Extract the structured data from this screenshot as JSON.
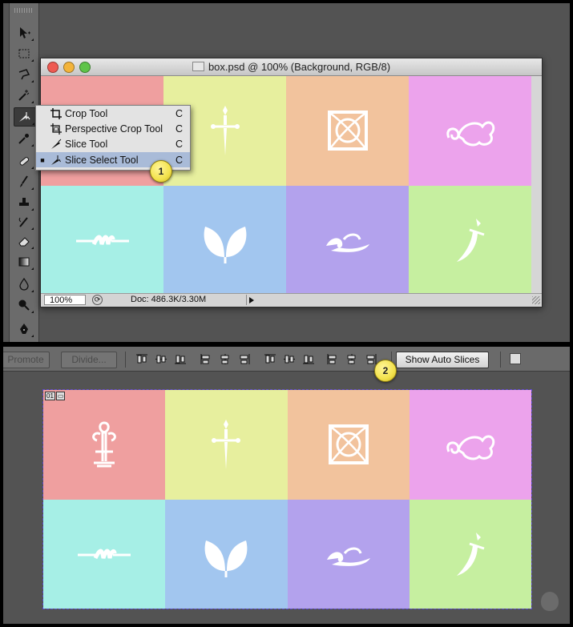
{
  "document": {
    "title": "box.psd @ 100% (Background, RGB/8)",
    "zoom": "100%",
    "doc_info": "Doc: 486.3K/3.30M"
  },
  "flyout_menu": {
    "items": [
      {
        "label": "Crop Tool",
        "key": "C",
        "selected": false,
        "icon": "crop-icon"
      },
      {
        "label": "Perspective Crop Tool",
        "key": "C",
        "selected": false,
        "icon": "perspective-crop-icon"
      },
      {
        "label": "Slice Tool",
        "key": "C",
        "selected": false,
        "icon": "slice-icon"
      },
      {
        "label": "Slice Select Tool",
        "key": "C",
        "selected": true,
        "icon": "slice-select-icon"
      }
    ],
    "bullet": "■"
  },
  "callouts": {
    "one": "1",
    "two": "2"
  },
  "options_bar": {
    "promote": "Promote",
    "divide": "Divide...",
    "show_auto_slices": "Show Auto Slices"
  },
  "slice_badge": {
    "number": "01"
  },
  "tiles": [
    {
      "color": "#ef9f9f",
      "ornament": "fleur-ornament"
    },
    {
      "color": "#e7ef9e",
      "ornament": "dagger-ornament"
    },
    {
      "color": "#f2c39d",
      "ornament": "square-knot-ornament"
    },
    {
      "color": "#eca3ec",
      "ornament": "swirl-leaf-ornament"
    },
    {
      "color": "#a6efe6",
      "ornament": "rope-divider-ornament"
    },
    {
      "color": "#a2c6ef",
      "ornament": "leaves-ornament"
    },
    {
      "color": "#b3a2ed",
      "ornament": "wave-ornament"
    },
    {
      "color": "#c6efa0",
      "ornament": "sword-ornament"
    }
  ],
  "colors": {
    "workspace": "#535353",
    "toolbox": "#6b6b6b",
    "menu_highlight": "#a9bbd8",
    "callout": "#f3e24c",
    "slice_border": "#5a48c8"
  }
}
